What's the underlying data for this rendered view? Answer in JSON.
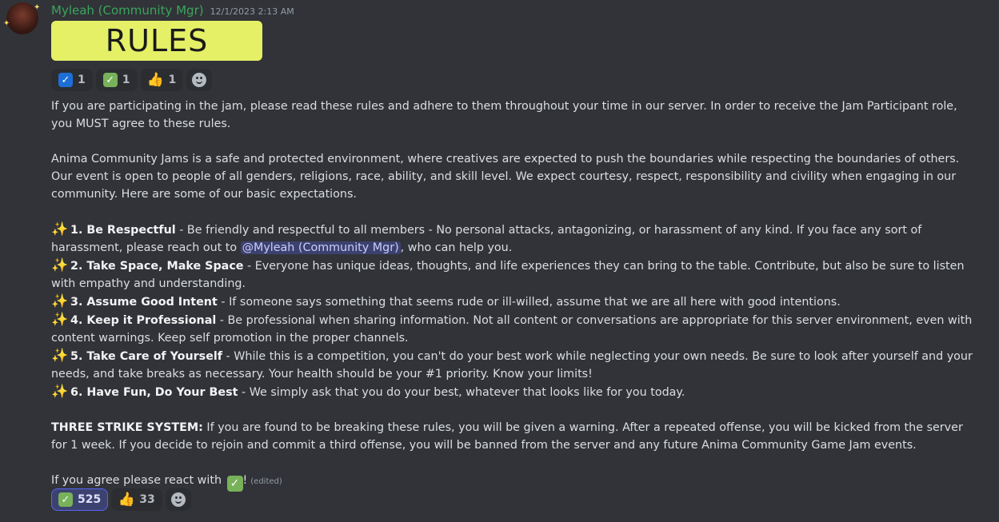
{
  "message": {
    "author": "Myleah (Community Mgr)",
    "timestamp": "12/1/2023 2:13 AM",
    "banner_text": "RULES",
    "top_reactions": [
      {
        "emoji": "blue-check-emoji",
        "count": "1"
      },
      {
        "emoji": "green-check-emoji",
        "count": "1"
      },
      {
        "emoji": "thumbs-up-emoji",
        "count": "1"
      }
    ],
    "intro": "If you are participating in the jam, please read these rules and adhere to them throughout your time in our server.  In order to receive the Jam Participant role, you MUST agree to these rules.",
    "description": "Anima Community Jams is a safe and protected environment, where creatives are expected to push the boundaries while respecting the boundaries of others. Our event is open to people of all genders, religions, race, ability, and skill level. We expect courtesy, respect, responsibility and civility when engaging in our community. Here are some of our basic expectations.",
    "rules": [
      {
        "title": "1. Be Respectful",
        "text_before": " -  Be friendly and respectful to all members - No personal attacks, antagonizing, or harassment of any kind. If you face any sort of harassment, please reach out to ",
        "mention": "@Myleah (Community Mgr)",
        "text_after": ", who can help you."
      },
      {
        "title": "2. Take Space, Make Space",
        "text": " - Everyone has unique ideas, thoughts, and life experiences they can bring to the table. Contribute, but also be sure to listen with empathy and understanding."
      },
      {
        "title": "3. Assume Good Intent",
        "text": " - If someone says something that seems rude or ill-willed, assume that we are all here with good intentions."
      },
      {
        "title": "4.  Keep it Professional",
        "text": " - Be professional when sharing information. Not all content or conversations are appropriate for this server environment, even with content warnings. Keep self promotion in the proper channels."
      },
      {
        "title": "5. Take Care of Yourself",
        "text": " - While this is a competition, you can't do your best work while neglecting your own needs. Be sure to look after yourself and your needs, and take breaks as necessary. Your health should be your #1 priority. Know your limits!"
      },
      {
        "title": "6. Have Fun, Do Your Best",
        "text": " - We simply ask that you do your best, whatever that looks like for you today."
      }
    ],
    "strike_title": "THREE STRIKE SYSTEM:",
    "strike_text": " If you are found to be breaking these rules, you will be given a warning. After a repeated offense, you will be kicked from the server for 1 week. If you decide to rejoin and commit a third offense, you will be banned from the server and any future Anima Community Game Jam events.",
    "agree_text": "If you agree please react with ",
    "agree_suffix": "!",
    "edited_label": "(edited)",
    "bottom_reactions": [
      {
        "emoji": "green-check-emoji",
        "count": "525",
        "active": true
      },
      {
        "emoji": "thumbs-up-emoji",
        "count": "33",
        "active": false
      }
    ]
  },
  "colors": {
    "background": "#313338",
    "username": "#3ba55d",
    "banner": "#e5f066",
    "mention_bg": "#5865f2",
    "sparkle": "#f7c948",
    "check": "#78b159"
  }
}
